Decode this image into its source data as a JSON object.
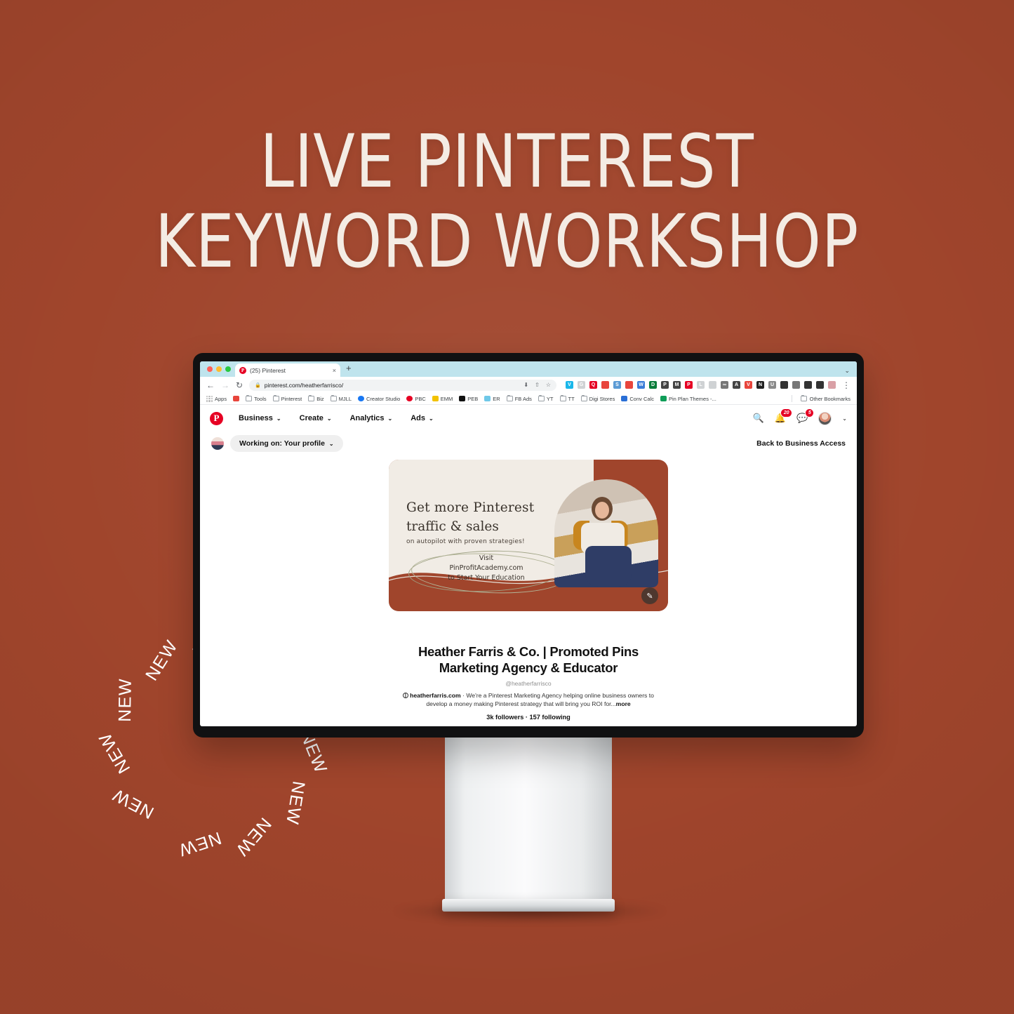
{
  "poster": {
    "bg_color": "#a0452c",
    "title_line1": "LIVE PINTEREST",
    "title_line2": "KEYWORD WORKSHOP",
    "badge_word": "NEW",
    "badge_repeat": 11
  },
  "browser": {
    "tab": {
      "title": "(25) Pinterest",
      "favicon": "pinterest-icon",
      "close": "×"
    },
    "new_tab_label": "+",
    "tabstrip_color": "#bfe4ed",
    "nav": {
      "back": "←",
      "forward": "→",
      "reload": "↻"
    },
    "url": "pinterest.com/heatherfarrisco/",
    "url_actions": [
      "install-icon",
      "share-icon",
      "star-icon"
    ],
    "extensions": [
      "V",
      "G",
      "Q",
      "102",
      "S",
      "28",
      "W",
      "D",
      "P",
      "M",
      "P",
      "L",
      "</>",
      "∞",
      "A",
      "V",
      "N",
      "U",
      "f?",
      "cam",
      "puzzle",
      "panel",
      "profile"
    ],
    "menu": "⋮",
    "bookmarks": [
      {
        "label": "Apps",
        "icon": "apps-grid-icon"
      },
      {
        "label": "",
        "icon": "colorful-icon"
      },
      {
        "label": "Tools",
        "icon": "folder-icon"
      },
      {
        "label": "Pinterest",
        "icon": "folder-icon"
      },
      {
        "label": "Biz",
        "icon": "folder-icon"
      },
      {
        "label": "MJLL",
        "icon": "folder-icon"
      },
      {
        "label": "Creator Studio",
        "icon": "meta-icon"
      },
      {
        "label": "PBC",
        "icon": "pinterest-icon"
      },
      {
        "label": "EMM",
        "icon": "yellow-icon"
      },
      {
        "label": "PEB",
        "icon": "black-icon"
      },
      {
        "label": "ER",
        "icon": "y-icon"
      },
      {
        "label": "FB Ads",
        "icon": "folder-icon"
      },
      {
        "label": "YT",
        "icon": "folder-icon"
      },
      {
        "label": "TT",
        "icon": "folder-icon"
      },
      {
        "label": "Digi Stores",
        "icon": "folder-icon"
      },
      {
        "label": "Conv Calc",
        "icon": "blue-icon"
      },
      {
        "label": "Pin Plan Themes -...",
        "icon": "sheets-icon"
      }
    ],
    "other_bookmarks": "Other Bookmarks"
  },
  "pinterest": {
    "logo": "pinterest-logo",
    "nav_items": [
      {
        "label": "Business"
      },
      {
        "label": "Create"
      },
      {
        "label": "Analytics"
      },
      {
        "label": "Ads"
      }
    ],
    "search_icon": "search-icon",
    "notifications_badge": "20",
    "messages_badge": "5",
    "working_on_label": "Working on: Your profile",
    "back_to_business": "Back to Business Access"
  },
  "banner": {
    "heading_line1": "Get more Pinterest",
    "heading_line2": "traffic & sales",
    "subheading": "on autopilot with proven strategies!",
    "cta_line1": "Visit",
    "cta_line2": "PinProfitAcademy.com",
    "cta_line3": "to Start Your Education",
    "edit_icon": "pencil-icon",
    "cream_color": "#f1ece5",
    "rust_color": "#a0452c"
  },
  "profile": {
    "avatar": "profile-avatar",
    "name_line1": "Heather Farris & Co. | Promoted Pins",
    "name_line2": "Marketing Agency & Educator",
    "handle": "@heatherfarrisco",
    "website": "heatherfarris.com",
    "separator": "·",
    "description": "We're a Pinterest Marketing Agency helping online business owners to develop a money making Pinterest strategy that will bring you ROI for...",
    "more_label": "more",
    "followers": "3k followers",
    "following": "157 following",
    "stats_separator": "·"
  }
}
